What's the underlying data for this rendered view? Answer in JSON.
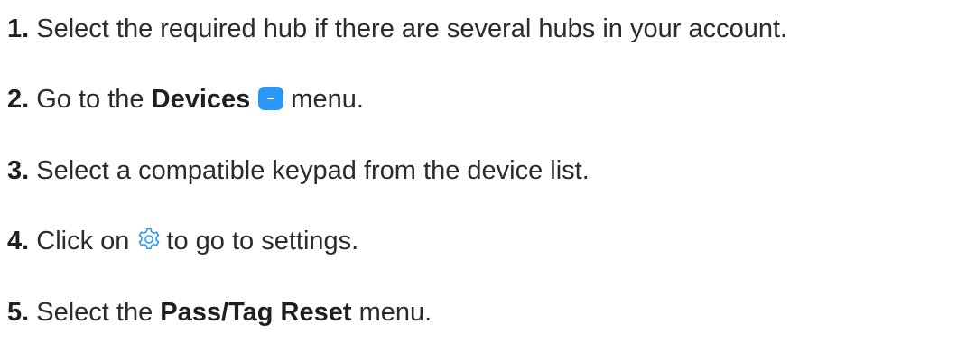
{
  "steps": [
    {
      "number": "1.",
      "text": "Select the required hub if there are several hubs in your account."
    },
    {
      "number": "2.",
      "before": "Go to the",
      "bold": "Devices",
      "icon": "devices-menu-icon",
      "after": "menu."
    },
    {
      "number": "3.",
      "text": "Select a compatible keypad from the device list."
    },
    {
      "number": "4.",
      "before": "Click on",
      "icon": "gear-icon",
      "after": "to go to settings."
    },
    {
      "number": "5.",
      "before": "Select the",
      "bold": "Pass/Tag Reset",
      "after": "menu."
    }
  ],
  "colors": {
    "text": "#2b2b2b",
    "accent": "#2b98f7"
  }
}
